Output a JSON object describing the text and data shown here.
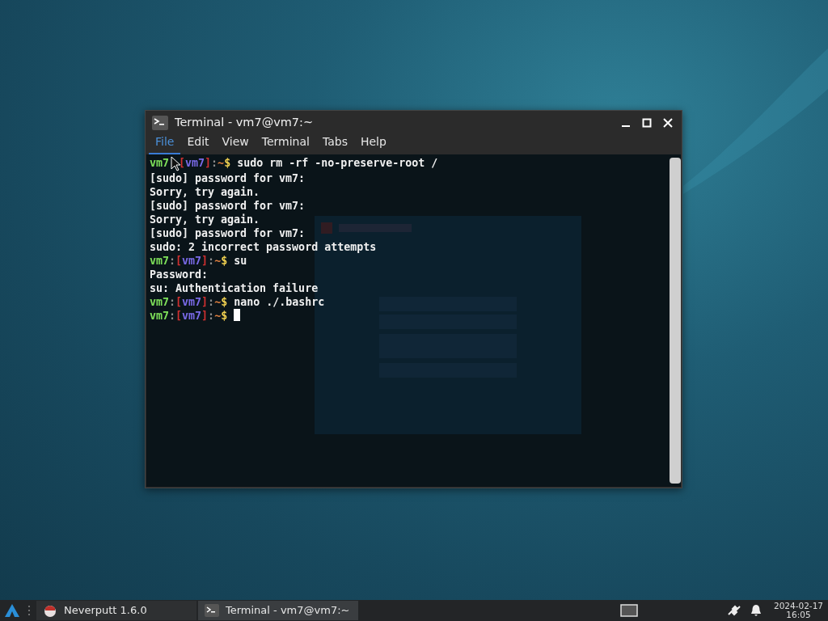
{
  "window": {
    "title": "Terminal - vm7@vm7:~",
    "menu": [
      {
        "label": "File",
        "selected": true
      },
      {
        "label": "Edit",
        "selected": false
      },
      {
        "label": "View",
        "selected": false
      },
      {
        "label": "Terminal",
        "selected": false
      },
      {
        "label": "Tabs",
        "selected": false
      },
      {
        "label": "Help",
        "selected": false
      }
    ]
  },
  "terminal": {
    "lines": [
      {
        "kind": "prompt",
        "pointer": true,
        "segments": [
          {
            "text": "vm7",
            "color": "#7ee05a"
          },
          {
            "text": "[",
            "color": "#d03030"
          },
          {
            "text": "vm7",
            "color": "#7a6ae8"
          },
          {
            "text": "]",
            "color": "#d03030"
          },
          {
            "text": ":",
            "color": "#8a8a8a"
          },
          {
            "text": "~",
            "color": "#e08040"
          },
          {
            "text": "$",
            "color": "#f0d050"
          }
        ],
        "command": "sudo rm -rf -no-preserve-root /"
      },
      {
        "kind": "output",
        "text": "[sudo] password for vm7:"
      },
      {
        "kind": "output",
        "text": "Sorry, try again."
      },
      {
        "kind": "output",
        "text": "[sudo] password for vm7:"
      },
      {
        "kind": "output",
        "text": "Sorry, try again."
      },
      {
        "kind": "output",
        "text": "[sudo] password for vm7:"
      },
      {
        "kind": "output",
        "text": "sudo: 2 incorrect password attempts"
      },
      {
        "kind": "prompt",
        "segments": [
          {
            "text": "vm7",
            "color": "#7ee05a"
          },
          {
            "text": ":",
            "color": "#8a8a8a"
          },
          {
            "text": "[",
            "color": "#d03030"
          },
          {
            "text": "vm7",
            "color": "#7a6ae8"
          },
          {
            "text": "]",
            "color": "#d03030"
          },
          {
            "text": ":",
            "color": "#8a8a8a"
          },
          {
            "text": "~",
            "color": "#e08040"
          },
          {
            "text": "$",
            "color": "#f0d050"
          }
        ],
        "command": "su"
      },
      {
        "kind": "output",
        "text": "Password:"
      },
      {
        "kind": "output",
        "text": "su: Authentication failure"
      },
      {
        "kind": "prompt",
        "segments": [
          {
            "text": "vm7",
            "color": "#7ee05a"
          },
          {
            "text": ":",
            "color": "#8a8a8a"
          },
          {
            "text": "[",
            "color": "#d03030"
          },
          {
            "text": "vm7",
            "color": "#7a6ae8"
          },
          {
            "text": "]",
            "color": "#d03030"
          },
          {
            "text": ":",
            "color": "#8a8a8a"
          },
          {
            "text": "~",
            "color": "#e08040"
          },
          {
            "text": "$",
            "color": "#f0d050"
          }
        ],
        "command": "nano ./.bashrc"
      },
      {
        "kind": "prompt",
        "segments": [
          {
            "text": "vm7",
            "color": "#7ee05a"
          },
          {
            "text": ":",
            "color": "#8a8a8a"
          },
          {
            "text": "[",
            "color": "#d03030"
          },
          {
            "text": "vm7",
            "color": "#7a6ae8"
          },
          {
            "text": "]",
            "color": "#d03030"
          },
          {
            "text": ":",
            "color": "#8a8a8a"
          },
          {
            "text": "~",
            "color": "#e08040"
          },
          {
            "text": "$",
            "color": "#f0d050"
          }
        ],
        "cursor": true
      }
    ]
  },
  "taskbar": {
    "tasks": [
      {
        "kind": "game",
        "label": "Neverputt 1.6.0",
        "selected": false
      },
      {
        "kind": "terminal",
        "label": "Terminal - vm7@vm7:~",
        "selected": true
      }
    ],
    "clock": {
      "date": "2024-02-17",
      "time": "16:05"
    }
  }
}
